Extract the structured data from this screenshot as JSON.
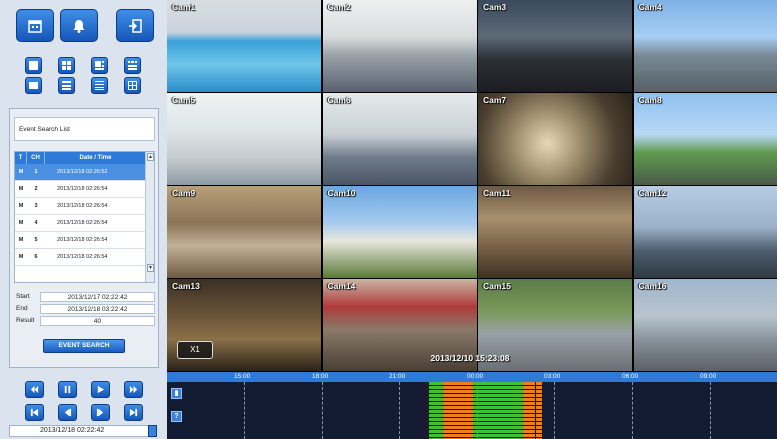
{
  "toolbar": {
    "top_buttons": [
      "calendar-icon",
      "bell-icon",
      "logout-icon"
    ],
    "layout_buttons": [
      "layout-1",
      "layout-4",
      "layout-6",
      "layout-9",
      "layout-8",
      "layout-13",
      "layout-16",
      "layout-fullscreen"
    ]
  },
  "event_search": {
    "title": "Event Search List",
    "columns": [
      "T",
      "CH",
      "Date / Time"
    ],
    "rows": [
      {
        "type": "M",
        "ch": "1",
        "time": "2013/12/18 02:26:52"
      },
      {
        "type": "M",
        "ch": "2",
        "time": "2013/12/18 02:26:54"
      },
      {
        "type": "M",
        "ch": "3",
        "time": "2013/12/18 02:26:54"
      },
      {
        "type": "M",
        "ch": "4",
        "time": "2013/12/18 02:26:54"
      },
      {
        "type": "M",
        "ch": "5",
        "time": "2013/12/18 02:26:54"
      },
      {
        "type": "M",
        "ch": "6",
        "time": "2013/12/18 02:26:54"
      }
    ],
    "selected_row": 0,
    "start_label": "Start",
    "start_value": "2013/12/17 02:22:42",
    "end_label": "End",
    "end_value": "2013/12/18 03:22:42",
    "result_label": "Result",
    "result_value": "40",
    "search_button": "EVENT SEARCH"
  },
  "playback": {
    "buttons": [
      "fast-rewind",
      "pause",
      "play",
      "fast-forward",
      "skip-start",
      "step-back",
      "step-forward",
      "skip-end"
    ],
    "date": "2013/12/18 02:22:42"
  },
  "cameras": [
    {
      "label": "Cam1"
    },
    {
      "label": "Cam2"
    },
    {
      "label": "Cam3"
    },
    {
      "label": "Cam4"
    },
    {
      "label": "Cam5"
    },
    {
      "label": "Cam6"
    },
    {
      "label": "Cam7"
    },
    {
      "label": "Cam8"
    },
    {
      "label": "Cam9"
    },
    {
      "label": "Cam10"
    },
    {
      "label": "Cam11"
    },
    {
      "label": "Cam12"
    },
    {
      "label": "Cam13"
    },
    {
      "label": "Cam14"
    },
    {
      "label": "Cam15"
    },
    {
      "label": "Cam16"
    }
  ],
  "overlay": {
    "zoom": "X1",
    "timestamp": "2013/12/10 15:23:08"
  },
  "timeline": {
    "ticks": [
      "15:00",
      "18:00",
      "21:00",
      "00:00",
      "03:00",
      "06:00",
      "09:00"
    ],
    "colors": {
      "motion": "#ef7f1a",
      "continuous": "#3fbf3a",
      "header": "#2f79d8"
    }
  }
}
